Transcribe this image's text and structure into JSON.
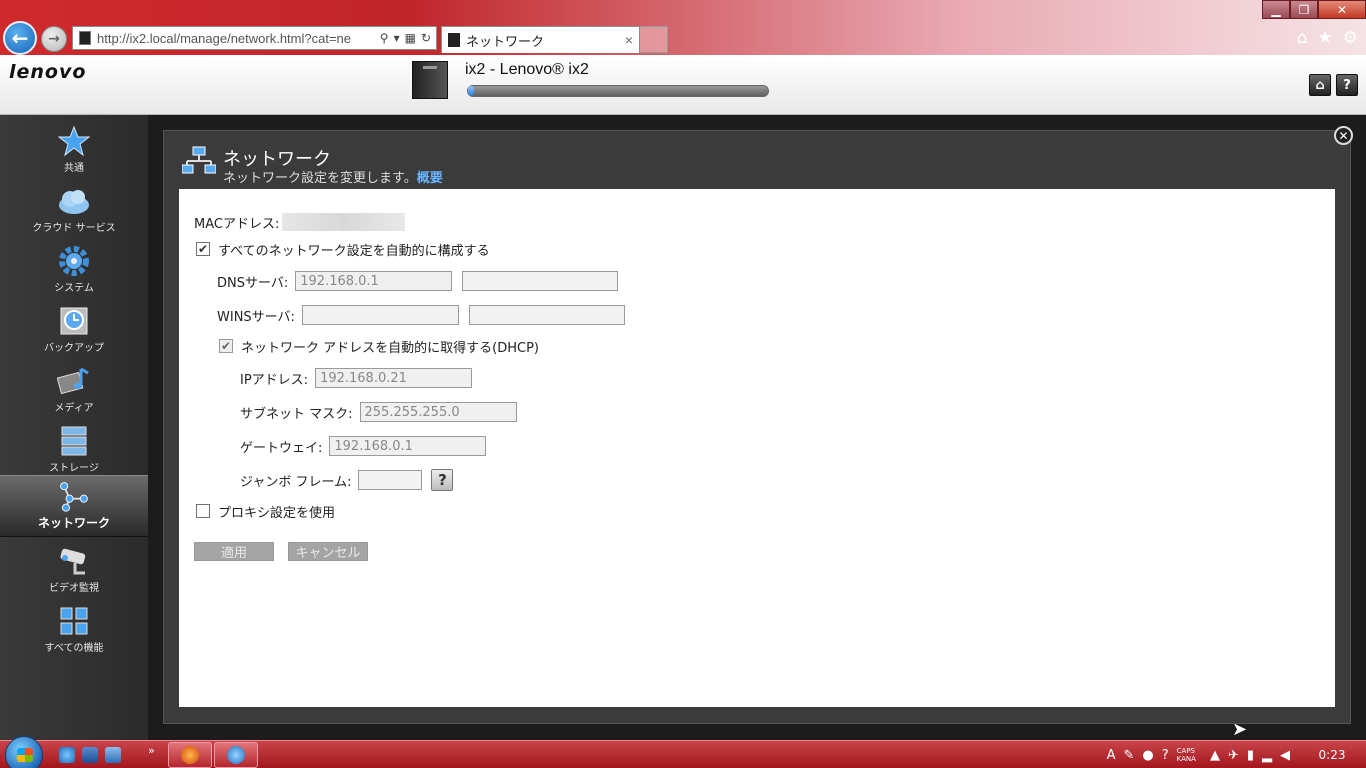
{
  "browser": {
    "url": "http://ix2.local/manage/network.html?cat=ne",
    "tab_title": "ネットワーク",
    "tab_close": "×"
  },
  "header": {
    "logo": "lenovo",
    "device_name": "ix2 - Lenovo® ix2",
    "capacity_used_fraction": 0.02
  },
  "sidebar": {
    "items": [
      {
        "label": "共通",
        "icon": "star-icon"
      },
      {
        "label": "クラウド サービス",
        "icon": "cloud-icon"
      },
      {
        "label": "システム",
        "icon": "gear-icon"
      },
      {
        "label": "バックアップ",
        "icon": "backup-clock-icon"
      },
      {
        "label": "メディア",
        "icon": "media-icon"
      },
      {
        "label": "ストレージ",
        "icon": "storage-icon"
      },
      {
        "label": "ネットワーク",
        "icon": "network-icon",
        "active": true
      },
      {
        "label": "ビデオ監視",
        "icon": "camera-icon"
      },
      {
        "label": "すべての機能",
        "icon": "grid-icon"
      }
    ]
  },
  "section": {
    "title": "ネットワーク",
    "description": "ネットワーク設定を変更します。",
    "overview_link": "概要"
  },
  "form": {
    "mac_label": "MACアドレス:",
    "auto_config_label": "すべてのネットワーク設定を自動的に構成する",
    "auto_config_checked": true,
    "dns_label": "DNSサーバ:",
    "dns_primary": "192.168.0.1",
    "dns_secondary": "",
    "wins_label": "WINSサーバ:",
    "wins_primary": "",
    "wins_secondary": "",
    "dhcp_label": "ネットワーク アドレスを自動的に取得する(DHCP)",
    "dhcp_checked": true,
    "ip_label": "IPアドレス:",
    "ip_value": "192.168.0.21",
    "subnet_label": "サブネット マスク:",
    "subnet_value": "255.255.255.0",
    "gateway_label": "ゲートウェイ:",
    "gateway_value": "192.168.0.1",
    "jumbo_label": "ジャンボ フレーム:",
    "jumbo_value": "",
    "help_label": "?",
    "proxy_label": "プロキシ設定を使用",
    "proxy_checked": false,
    "apply_label": "適用",
    "cancel_label": "キャンセル"
  },
  "taskbar": {
    "ime_line1": "CAPS",
    "ime_line2": "KANA",
    "clock": "0:23"
  }
}
